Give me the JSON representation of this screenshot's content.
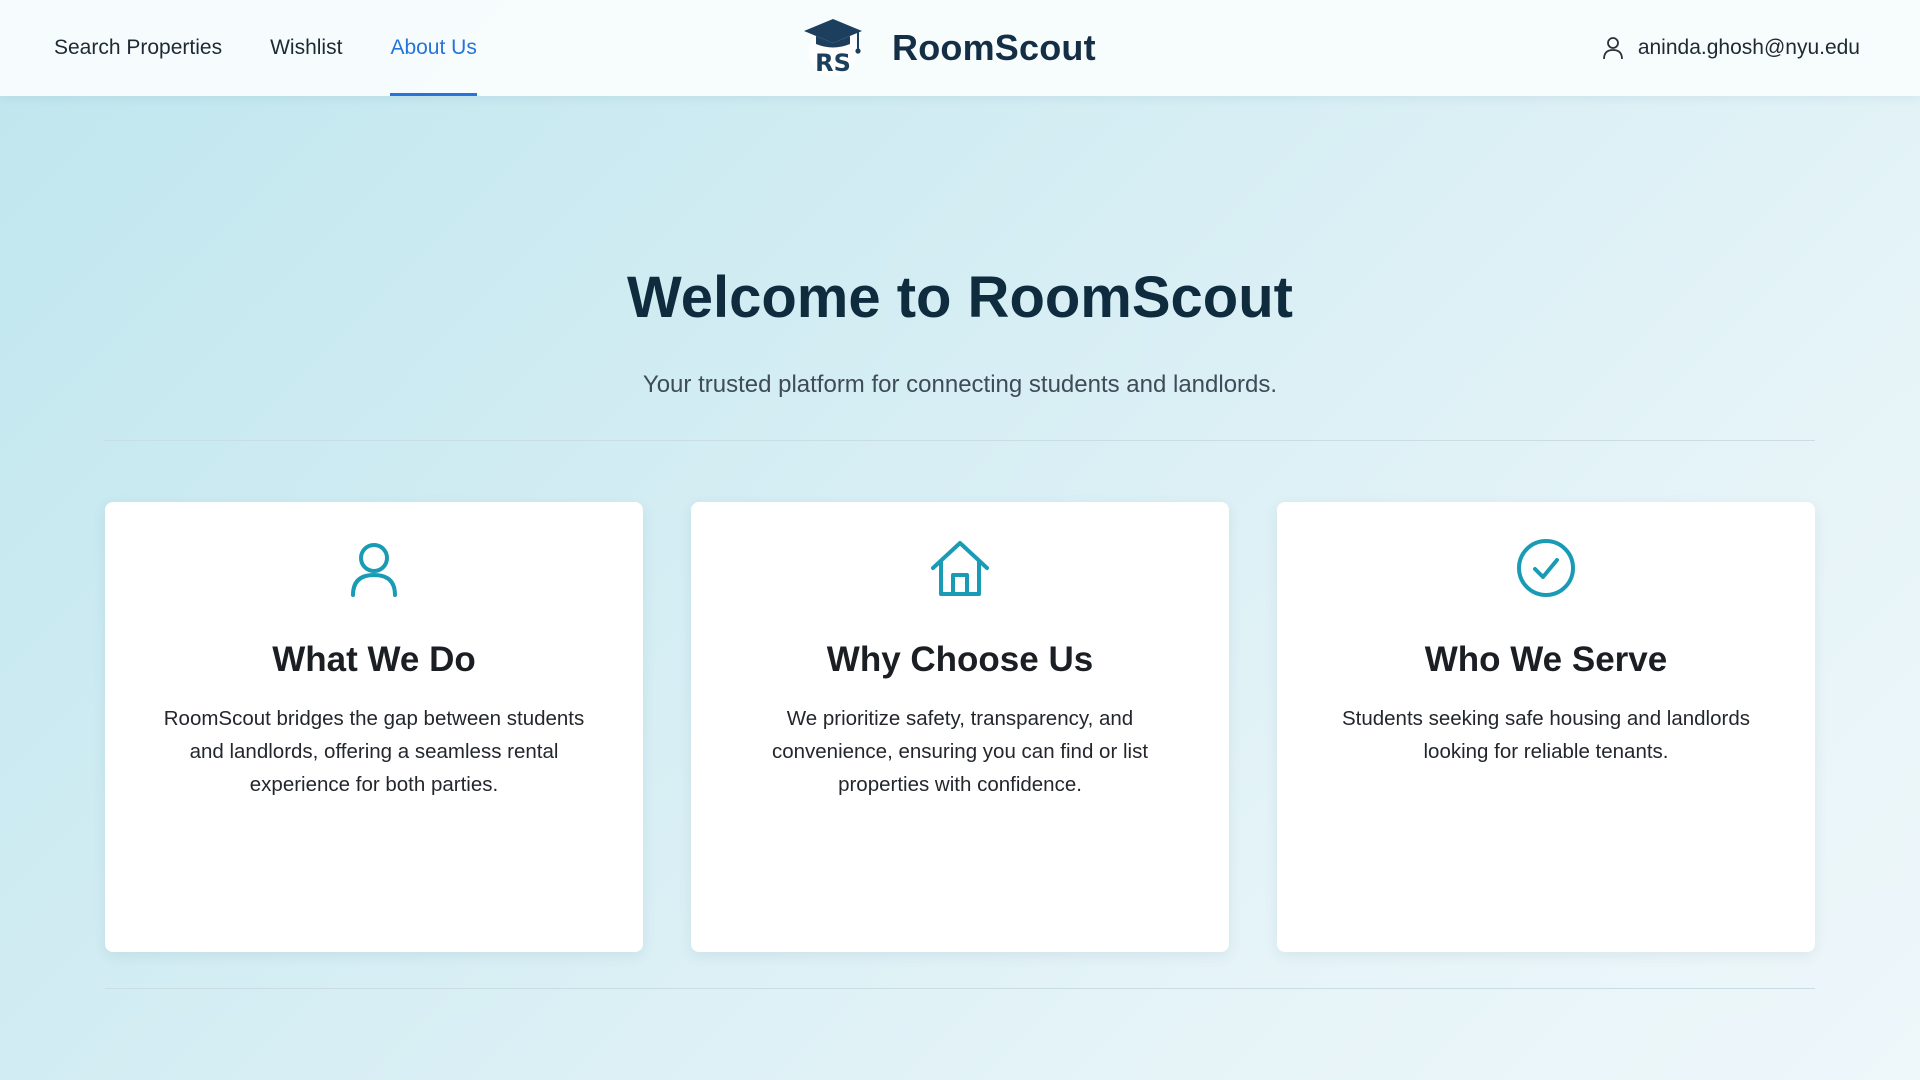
{
  "nav": {
    "items": [
      {
        "label": "Search Properties"
      },
      {
        "label": "Wishlist"
      },
      {
        "label": "About Us"
      }
    ]
  },
  "brand": {
    "name": "RoomScout",
    "logo_text": "RS"
  },
  "user": {
    "email": "aninda.ghosh@nyu.edu",
    "icon": "user-icon"
  },
  "hero": {
    "title": "Welcome to RoomScout",
    "subtitle": "Your trusted platform for connecting students and landlords."
  },
  "cards": [
    {
      "icon": "user-icon",
      "title": "What We Do",
      "text": "RoomScout bridges the gap between students and landlords, offering a seamless rental experience for both parties."
    },
    {
      "icon": "house-icon",
      "title": "Why Choose Us",
      "text": "We prioritize safety, transparency, and convenience, ensuring you can find or list properties with confidence."
    },
    {
      "icon": "check-circle-icon",
      "title": "Who We Serve",
      "text": "Students seeking safe housing and landlords looking for reliable tenants."
    }
  ],
  "colors": {
    "accent": "#2673d9",
    "icon_teal": "#1a9bb5",
    "brand_navy": "#142e45"
  }
}
